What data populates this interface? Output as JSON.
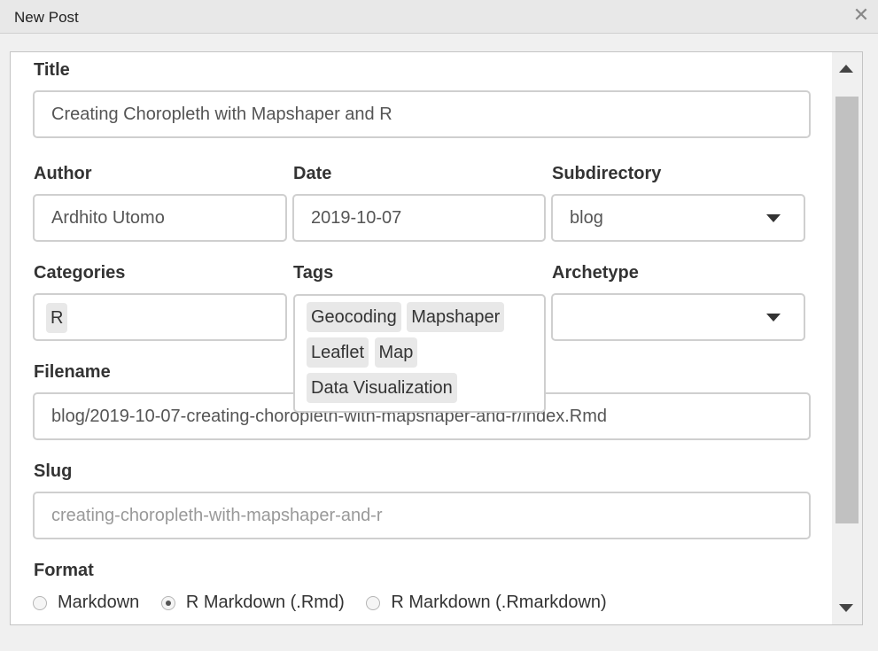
{
  "window": {
    "title": "New Post",
    "close_glyph": "✕"
  },
  "form": {
    "title": {
      "label": "Title",
      "value": "Creating Choropleth with Mapshaper and R"
    },
    "author": {
      "label": "Author",
      "value": "Ardhito Utomo"
    },
    "date": {
      "label": "Date",
      "value": "2019-10-07"
    },
    "subdirectory": {
      "label": "Subdirectory",
      "value": "blog"
    },
    "categories": {
      "label": "Categories",
      "items": [
        "R"
      ]
    },
    "tags": {
      "label": "Tags",
      "items": [
        "Geocoding",
        "Mapshaper",
        "Leaflet",
        "Map",
        "Data Visualization"
      ]
    },
    "archetype": {
      "label": "Archetype",
      "value": ""
    },
    "filename": {
      "label": "Filename",
      "value": "blog/2019-10-07-creating-choropleth-with-mapshaper-and-r/index.Rmd"
    },
    "slug": {
      "label": "Slug",
      "placeholder": "creating-choropleth-with-mapshaper-and-r"
    },
    "format": {
      "label": "Format",
      "options": [
        "Markdown",
        "R Markdown (.Rmd)",
        "R Markdown (.Rmarkdown)"
      ],
      "selected": "R Markdown (.Rmd)"
    }
  },
  "icons": {
    "close": "close-icon",
    "dropdown": "chevron-down-icon",
    "scroll_up": "scroll-up-arrow-icon",
    "scroll_down": "scroll-down-arrow-icon"
  },
  "colors": {
    "field_border": "#cfcfcf",
    "chip_background": "#e8e8e8",
    "scroll_thumb": "#c1c1c1"
  }
}
